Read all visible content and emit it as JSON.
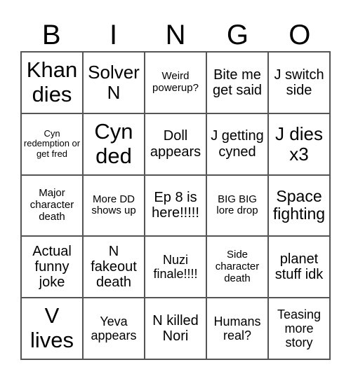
{
  "header": [
    "B",
    "I",
    "N",
    "G",
    "O"
  ],
  "cells": [
    {
      "text": "Khan dies",
      "size": "s-xl"
    },
    {
      "text": "Solver N",
      "size": "s-l"
    },
    {
      "text": "Weird powerup?",
      "size": "s-s"
    },
    {
      "text": "Bite me get said",
      "size": "s-m"
    },
    {
      "text": "J switch side",
      "size": "s-m"
    },
    {
      "text": "Cyn redemption or get fred",
      "size": "s-xs"
    },
    {
      "text": "Cyn ded",
      "size": "s-xl"
    },
    {
      "text": "Doll appears",
      "size": "s-m"
    },
    {
      "text": "J getting cyned",
      "size": "s-m"
    },
    {
      "text": "J dies x3",
      "size": "s-l"
    },
    {
      "text": "Major character death",
      "size": "s-s"
    },
    {
      "text": "More DD shows up",
      "size": "s-s"
    },
    {
      "text": "Ep 8 is here!!!!!",
      "size": "s-m"
    },
    {
      "text": "BIG BIG lore drop",
      "size": "s-s"
    },
    {
      "text": "Space fighting",
      "size": "s-ml"
    },
    {
      "text": "Actual funny joke",
      "size": "s-m"
    },
    {
      "text": "N fakeout death",
      "size": "s-m"
    },
    {
      "text": "Nuzi finale!!!!",
      "size": "s-sm"
    },
    {
      "text": "Side character death",
      "size": "s-s"
    },
    {
      "text": "planet stuff idk",
      "size": "s-m"
    },
    {
      "text": "V lives",
      "size": "s-xl"
    },
    {
      "text": "Yeva appears",
      "size": "s-sm"
    },
    {
      "text": "N killed Nori",
      "size": "s-m"
    },
    {
      "text": "Humans real?",
      "size": "s-sm"
    },
    {
      "text": "Teasing more story",
      "size": "s-sm"
    }
  ]
}
